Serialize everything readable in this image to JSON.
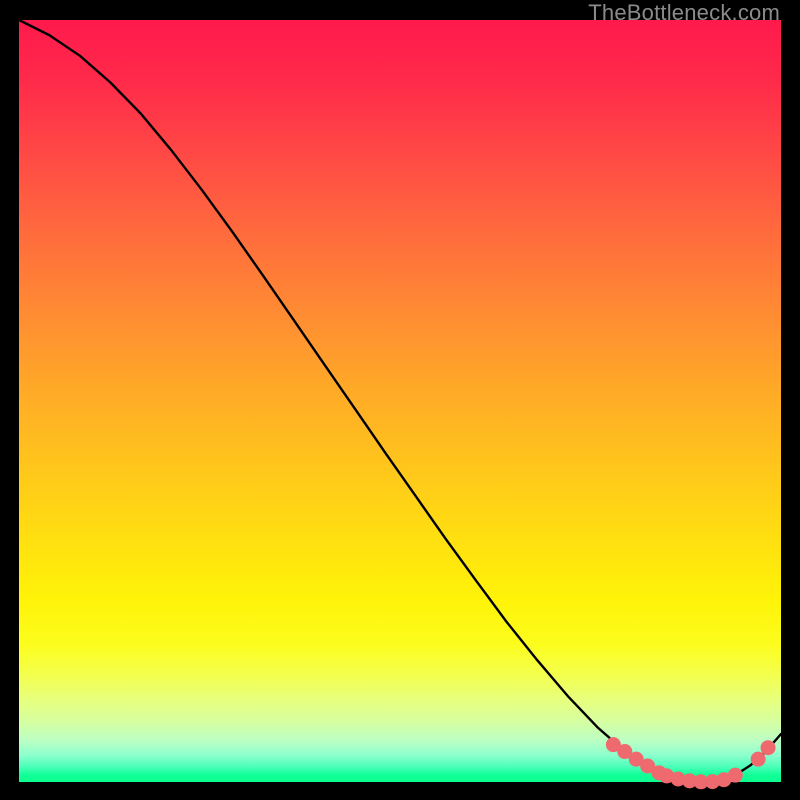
{
  "watermark": "TheBottleneck.com",
  "chart_data": {
    "type": "line",
    "title": "",
    "xlabel": "",
    "ylabel": "",
    "xlim": [
      0,
      100
    ],
    "ylim": [
      0,
      100
    ],
    "series": [
      {
        "name": "curve",
        "x": [
          0,
          4,
          8,
          12,
          16,
          20,
          24,
          28,
          32,
          36,
          40,
          44,
          48,
          52,
          56,
          60,
          64,
          68,
          72,
          76,
          80,
          82,
          84,
          86,
          88,
          90,
          92,
          94,
          96,
          98,
          100
        ],
        "y": [
          100,
          98.0,
          95.3,
          91.8,
          87.7,
          82.9,
          77.7,
          72.2,
          66.5,
          60.7,
          54.9,
          49.1,
          43.3,
          37.6,
          31.9,
          26.4,
          21.0,
          16.0,
          11.3,
          7.1,
          3.6,
          2.2,
          1.2,
          0.5,
          0.1,
          0.0,
          0.2,
          0.9,
          2.2,
          4.0,
          6.3
        ]
      }
    ],
    "markers": {
      "name": "highlight-dots",
      "color": "#ee6a6f",
      "points": [
        {
          "x": 78.0,
          "y": 4.9
        },
        {
          "x": 79.5,
          "y": 4.0
        },
        {
          "x": 81.0,
          "y": 3.0
        },
        {
          "x": 82.5,
          "y": 2.1
        },
        {
          "x": 84.0,
          "y": 1.2
        },
        {
          "x": 85.0,
          "y": 0.8
        },
        {
          "x": 86.5,
          "y": 0.4
        },
        {
          "x": 88.0,
          "y": 0.15
        },
        {
          "x": 89.5,
          "y": 0.03
        },
        {
          "x": 91.0,
          "y": 0.05
        },
        {
          "x": 92.5,
          "y": 0.3
        },
        {
          "x": 94.0,
          "y": 0.9
        },
        {
          "x": 97.0,
          "y": 3.0
        },
        {
          "x": 98.3,
          "y": 4.5
        }
      ]
    }
  }
}
